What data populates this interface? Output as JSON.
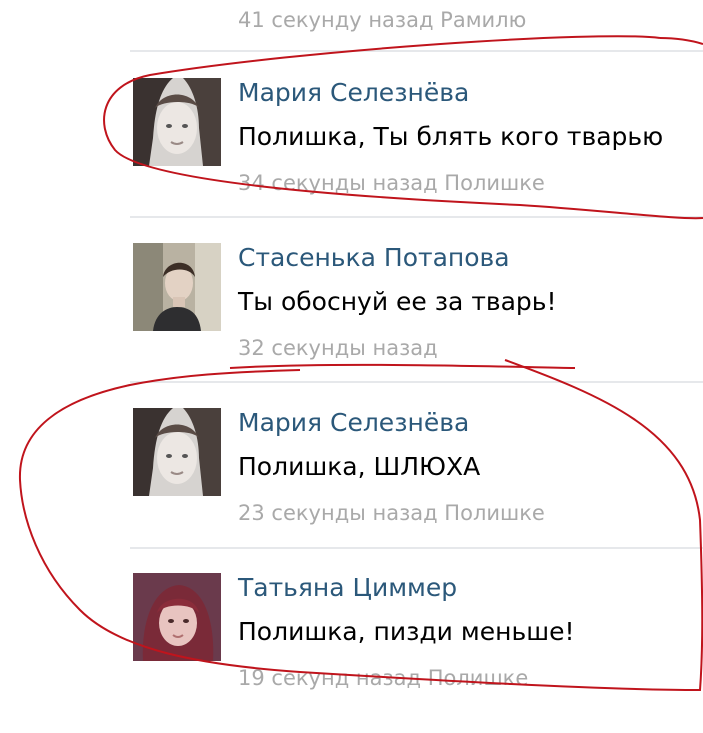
{
  "previous_comment": {
    "meta": "41 секунду назад Рамилю"
  },
  "comments": [
    {
      "author": "Мария Селезнёва",
      "text": "Полишка, Ты блять кого тварью",
      "meta": "34 секунды назад Полишке",
      "avatar_icon": "girl-photo-grayscale"
    },
    {
      "author": "Стасенька Потапова",
      "text": "Ты обоснуй ее за тварь!",
      "meta": "32 секунды назад",
      "avatar_icon": "boy-photo"
    },
    {
      "author": "Мария Селезнёва",
      "text": "Полишка, ШЛЮХА",
      "meta": "23 секунды назад Полишке",
      "avatar_icon": "girl-photo-grayscale"
    },
    {
      "author": "Татьяна Циммер",
      "text": "Полишка, пизди меньше!",
      "meta": "19 секунд назад Полишке",
      "avatar_icon": "girl-photo-red-hair"
    }
  ],
  "colors": {
    "author_link": "#2b587a",
    "meta_gray": "#a9a9a9",
    "annotation_red": "#c0141c"
  }
}
